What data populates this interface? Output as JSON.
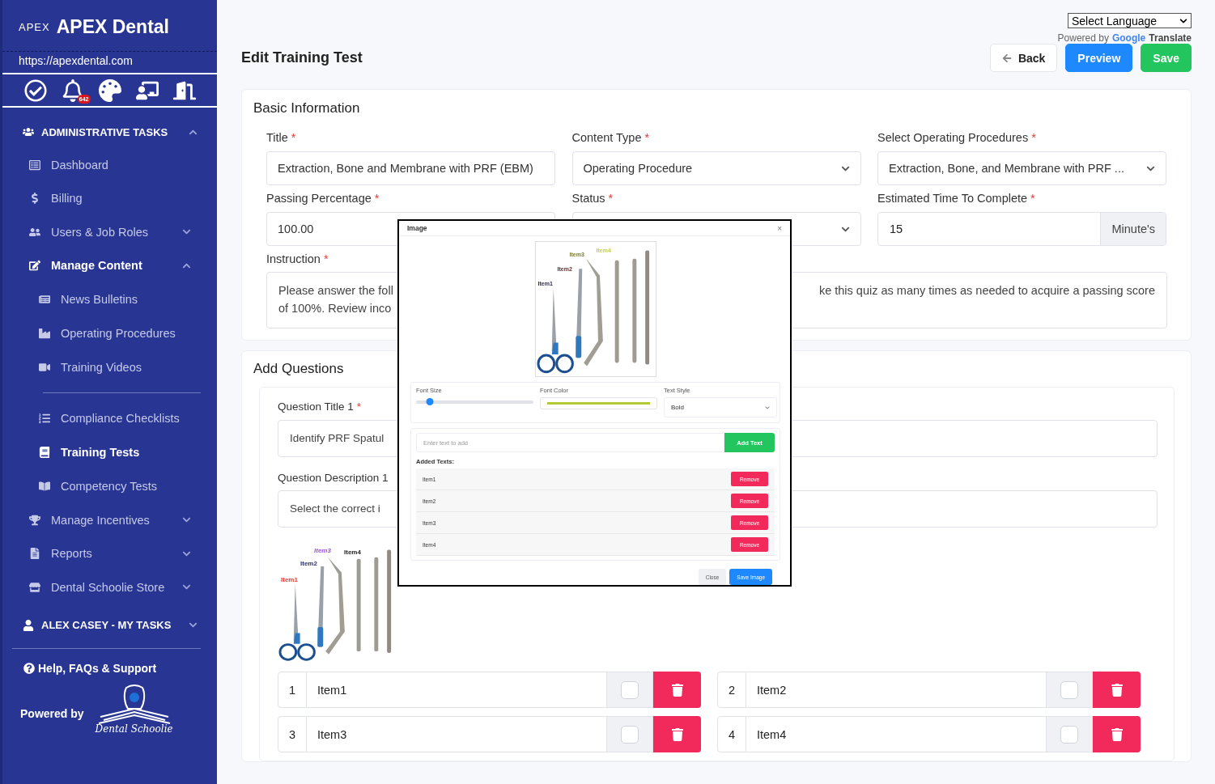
{
  "sidebar": {
    "logo_mark": "APEX",
    "brand": "APEX Dental",
    "url": "https://apexdental.com",
    "notification_count": "642",
    "sections": [
      {
        "label": "ADMINISTRATIVE TASKS",
        "expanded": true,
        "items": [
          {
            "kind": "link",
            "label": "Dashboard",
            "selected": false
          },
          {
            "kind": "link",
            "label": "Billing",
            "selected": false
          },
          {
            "kind": "group",
            "label": "Users & Job Roles",
            "expanded": false
          },
          {
            "kind": "group",
            "label": "Manage Content",
            "expanded": true,
            "children": [
              {
                "kind": "link",
                "label": "News Bulletins",
                "selected": false
              },
              {
                "kind": "link",
                "label": "Operating Procedures",
                "selected": false
              },
              {
                "kind": "link",
                "label": "Training Videos",
                "selected": false
              },
              {
                "kind": "divider"
              },
              {
                "kind": "link",
                "label": "Compliance Checklists",
                "selected": false
              },
              {
                "kind": "link",
                "label": "Training Tests",
                "selected": true
              },
              {
                "kind": "link",
                "label": "Competency Tests",
                "selected": false
              }
            ]
          },
          {
            "kind": "group",
            "label": "Manage Incentives",
            "expanded": false
          },
          {
            "kind": "group",
            "label": "Reports",
            "expanded": false
          },
          {
            "kind": "group",
            "label": "Dental Schoolie Store",
            "expanded": false
          }
        ]
      },
      {
        "label": "ALEX CASEY - MY TASKS",
        "expanded": false
      }
    ],
    "help": "Help, FAQs & Support",
    "powered_by": "Powered by",
    "partner_logo": "Dental Schoolie"
  },
  "translate": {
    "select": "Select Language",
    "powered_by": "Powered by",
    "google": "Google",
    "translate": "Translate"
  },
  "header": {
    "title": "Edit Training Test",
    "buttons": [
      {
        "kind": "back",
        "label": "Back"
      },
      {
        "kind": "preview",
        "label": "Preview"
      },
      {
        "kind": "save",
        "label": "Save"
      }
    ]
  },
  "basic_info": {
    "heading": "Basic Information",
    "fields": [
      {
        "kind": "input",
        "label": "Title",
        "required_mark": "*",
        "value": "Extraction, Bone and Membrane with PRF (EBM)"
      },
      {
        "kind": "select",
        "label": "Content Type",
        "required_mark": "*",
        "value": "Operating Procedure"
      },
      {
        "kind": "select",
        "label": "Select Operating Procedures",
        "required_mark": "*",
        "value": "Extraction, Bone, and Membrane with PRF ..."
      },
      {
        "kind": "input",
        "label": "Passing Percentage",
        "required_mark": "*",
        "value": "100.00"
      },
      {
        "kind": "select",
        "label": "Status",
        "required_mark": "*"
      },
      {
        "kind": "addon",
        "label": "Estimated Time To Complete",
        "required_mark": "*",
        "value": "15",
        "addon": "Minute's"
      }
    ],
    "instruction": {
      "label": "Instruction",
      "required_mark": "*",
      "left_lines": [
        "Please answer the foll",
        "of 100%. Review inco"
      ],
      "right_lines": [
        "ke this quiz as many times as needed to acquire a passing score"
      ]
    }
  },
  "questions": {
    "heading": "Add Questions",
    "title_label": "Question Title 1",
    "title_required_mark": "*",
    "title_value": "Identify PRF Spatul",
    "description_label": "Question Description 1",
    "description_value": "Select the correct i",
    "image_labels": [
      {
        "text": "Item1",
        "color": "#e53935"
      },
      {
        "text": "Item2",
        "color": "#2a2f6e"
      },
      {
        "text": "Item3",
        "color": "#9b59d6"
      },
      {
        "text": "Item4",
        "color": "#222222"
      }
    ],
    "answers": [
      {
        "number": "1",
        "text": "Item1",
        "checked": false
      },
      {
        "number": "2",
        "text": "Item2",
        "checked": false
      },
      {
        "number": "3",
        "text": "Item3",
        "checked": false
      },
      {
        "number": "4",
        "text": "Item4",
        "checked": false
      }
    ]
  },
  "modal": {
    "title": "Image",
    "close": "×",
    "image_labels": [
      {
        "text": "Item1",
        "color": "#2a2f5e"
      },
      {
        "text": "Item2",
        "color": "#6b2a2a"
      },
      {
        "text": "Item3",
        "color": "#7a7a3a"
      },
      {
        "text": "Item4",
        "color": "#c5d430"
      }
    ],
    "font_size": {
      "label": "Font Size",
      "level": 0.12
    },
    "font_color": {
      "label": "Font Color",
      "color": "#b5c935"
    },
    "text_style": {
      "label": "Text Style",
      "value": "Bold"
    },
    "text_input": {
      "placeholder": "Enter text to add"
    },
    "add_button": "Add Text",
    "added_heading": "Added Texts:",
    "added_texts": [
      {
        "text": "Item1",
        "action": "Remove"
      },
      {
        "text": "Item2",
        "action": "Remove"
      },
      {
        "text": "Item3",
        "action": "Remove"
      },
      {
        "text": "Item4",
        "action": "Remove"
      }
    ],
    "buttons": [
      {
        "kind": "close",
        "label": "Close"
      },
      {
        "kind": "save",
        "label": "Save Image"
      }
    ]
  }
}
